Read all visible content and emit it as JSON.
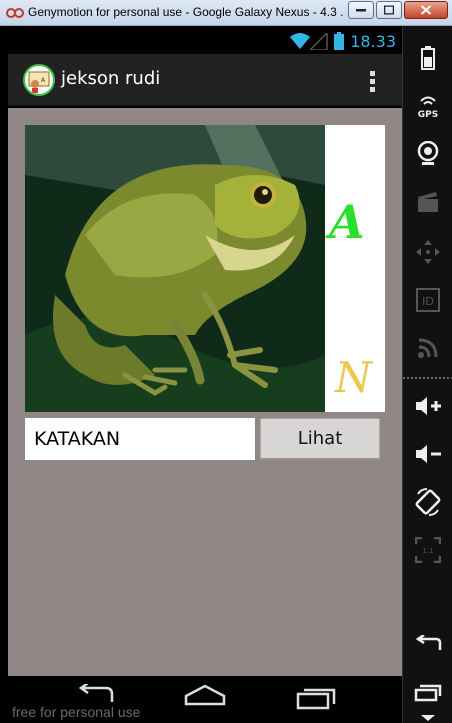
{
  "window": {
    "title": "Genymotion for personal use - Google Galaxy Nexus - 4.3 ...",
    "controls": [
      "minimize",
      "maximize",
      "close"
    ]
  },
  "status_bar": {
    "time": "18.33",
    "icons": [
      "wifi-icon",
      "signal-icon",
      "battery-icon"
    ]
  },
  "action_bar": {
    "title": "jekson rudi",
    "overflow_icon": "overflow-menu-icon"
  },
  "main": {
    "image": {
      "subject": "frog-photo",
      "letters": [
        "A",
        "N"
      ]
    },
    "input": {
      "value": "KATAKAN",
      "placeholder": ""
    },
    "button_label": "Lihat"
  },
  "navigation": [
    "back-icon",
    "home-icon",
    "recent-apps-icon"
  ],
  "watermark": "free for personal use",
  "toolbar": [
    "battery-icon",
    "gps-icon",
    "webcam-icon",
    "capture-icon",
    "dpad-icon",
    "id-icon",
    "rss-icon",
    "volume-up-icon",
    "volume-down-icon",
    "rotate-icon",
    "scale-icon",
    "back-icon",
    "recent-apps-icon",
    "menu-icon"
  ],
  "colors": {
    "background": "#908686",
    "accent": "#33b5e5",
    "action_bar": "#222222",
    "letter_a": "#27e02a",
    "letter_n": "#eac84a"
  }
}
